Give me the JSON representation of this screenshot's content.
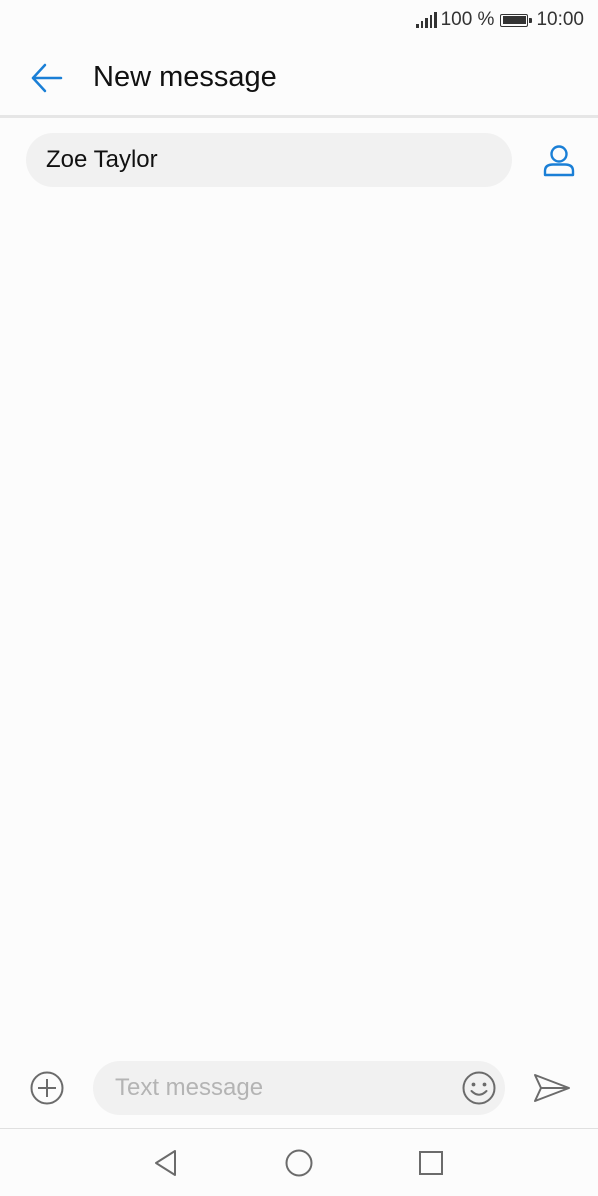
{
  "status_bar": {
    "battery_percent": "100 %",
    "battery_level": 1.0,
    "time": "10:00",
    "icons": [
      "signal-icon",
      "battery-icon"
    ]
  },
  "header": {
    "title": "New message",
    "back_icon": "arrow-left-icon"
  },
  "recipient": {
    "value": "Zoe Taylor",
    "contact_icon": "person-icon"
  },
  "compose": {
    "placeholder": "Text message",
    "value": "",
    "attach_icon": "plus-circle-icon",
    "emoji_icon": "smiley-icon",
    "send_icon": "send-icon"
  },
  "nav_bar": {
    "icons": [
      "back-triangle-icon",
      "home-circle-icon",
      "recents-square-icon"
    ]
  },
  "colors": {
    "accent": "#1a7fd6",
    "background": "#fcfcfc",
    "field_background": "#f1f1f1",
    "placeholder": "#b4b4b4",
    "icon_gray": "#6b6b6b"
  }
}
